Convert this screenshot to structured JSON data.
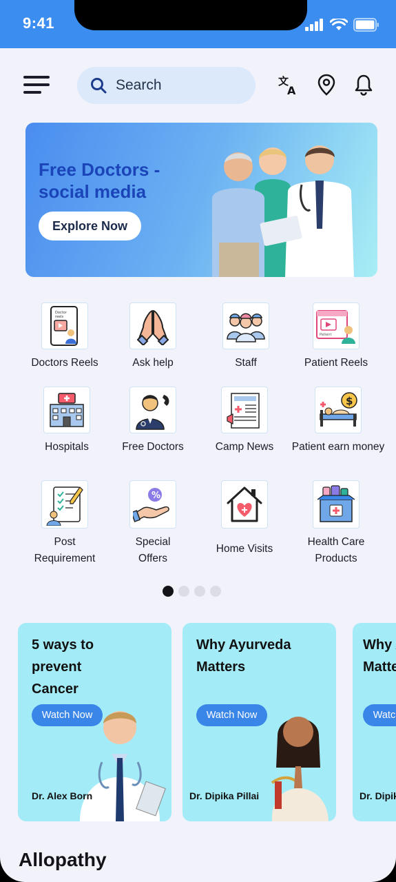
{
  "status_bar": {
    "time": "9:41"
  },
  "header": {
    "search_placeholder": "Search"
  },
  "banner": {
    "title": "Free Doctors - social media",
    "button": "Explore Now"
  },
  "services": [
    {
      "label": "Doctors Reels",
      "icon": "doctor-reels-icon"
    },
    {
      "label": "Ask help",
      "icon": "praying-hands-icon"
    },
    {
      "label": "Staff",
      "icon": "nurses-staff-icon"
    },
    {
      "label": "Patient Reels",
      "icon": "patient-reels-icon"
    },
    {
      "label": "Hospitals",
      "icon": "hospital-building-icon"
    },
    {
      "label": "Free Doctors",
      "icon": "doctor-phone-icon"
    },
    {
      "label": "Camp News",
      "icon": "newspaper-icon"
    },
    {
      "label": "Patient earn money",
      "icon": "patient-bed-money-icon"
    },
    {
      "label": "Post Requirement",
      "icon": "clipboard-checklist-icon"
    },
    {
      "label": "Special Offers",
      "icon": "discount-hand-icon"
    },
    {
      "label": "Home Visits",
      "icon": "home-heart-icon"
    },
    {
      "label": "Health Care Products",
      "icon": "medicine-box-icon"
    }
  ],
  "pagination": {
    "pages": 4,
    "active": 1
  },
  "videos": [
    {
      "title": "5 ways to prevent Cancer",
      "button": "Watch Now",
      "doctor": "Dr. Alex Born"
    },
    {
      "title": "Why Ayurveda Matters",
      "button": "Watch Now",
      "doctor": "Dr. Dipika Pillai"
    },
    {
      "title": "Why Ayurveda Matters",
      "button": "Watch Now",
      "doctor": "Dr. Dipika Pillai"
    }
  ],
  "section": {
    "title": "Allopathy"
  },
  "colors": {
    "status_bar": "#3b8ef0",
    "card_bg": "#a3ecf7",
    "accent": "#3a86e8",
    "banner_title": "#1b44b8"
  }
}
